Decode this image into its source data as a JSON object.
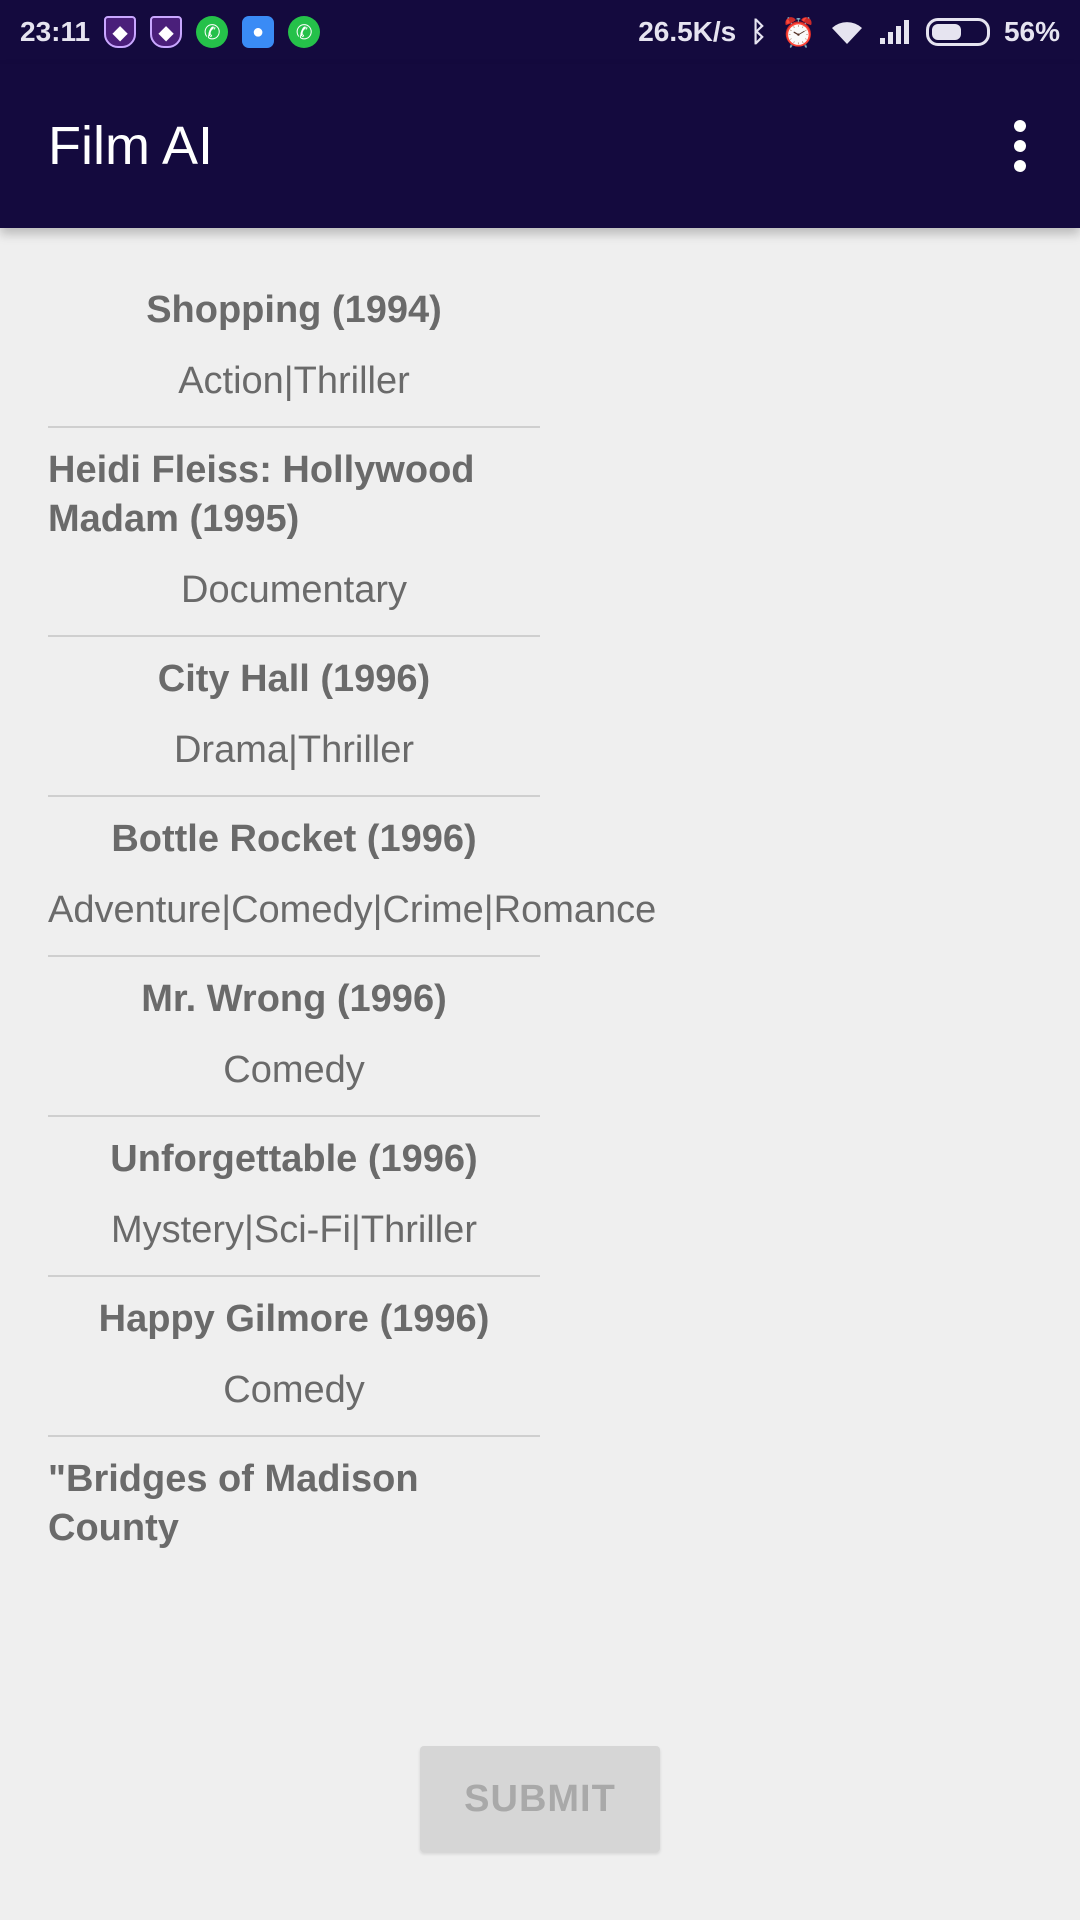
{
  "status_bar": {
    "time": "23:11",
    "network_speed": "26.5K/s",
    "battery_percent": "56%",
    "battery_level": 0.56,
    "notification_icons": [
      "shield-icon",
      "shield-icon",
      "whatsapp-icon",
      "messenger-icon",
      "whatsapp-icon"
    ],
    "system_icons": [
      "bluetooth-icon",
      "alarm-icon",
      "wifi-icon",
      "signal-icon",
      "battery-icon"
    ]
  },
  "app_bar": {
    "title": "Film AI",
    "menu_icon": "more-vertical-icon"
  },
  "movies": [
    {
      "title": "Shopping (1994)",
      "genres": "Action|Thriller"
    },
    {
      "title": "Heidi Fleiss: Hollywood Madam (1995)",
      "genres": "Documentary"
    },
    {
      "title": "City Hall (1996)",
      "genres": "Drama|Thriller"
    },
    {
      "title": "Bottle Rocket (1996)",
      "genres": "Adventure|Comedy|Crime|Romance"
    },
    {
      "title": "Mr. Wrong (1996)",
      "genres": "Comedy"
    },
    {
      "title": "Unforgettable (1996)",
      "genres": "Mystery|Sci-Fi|Thriller"
    },
    {
      "title": "Happy Gilmore (1996)",
      "genres": "Comedy"
    },
    {
      "title": "\"Bridges of Madison County",
      "genres": ""
    }
  ],
  "submit_button": {
    "label": "SUBMIT"
  },
  "colors": {
    "app_bar_bg": "#140a3e",
    "background": "#efefef",
    "text": "#6a6a6a",
    "button_bg": "#d6d6d6",
    "button_text": "#a9a9a9"
  }
}
